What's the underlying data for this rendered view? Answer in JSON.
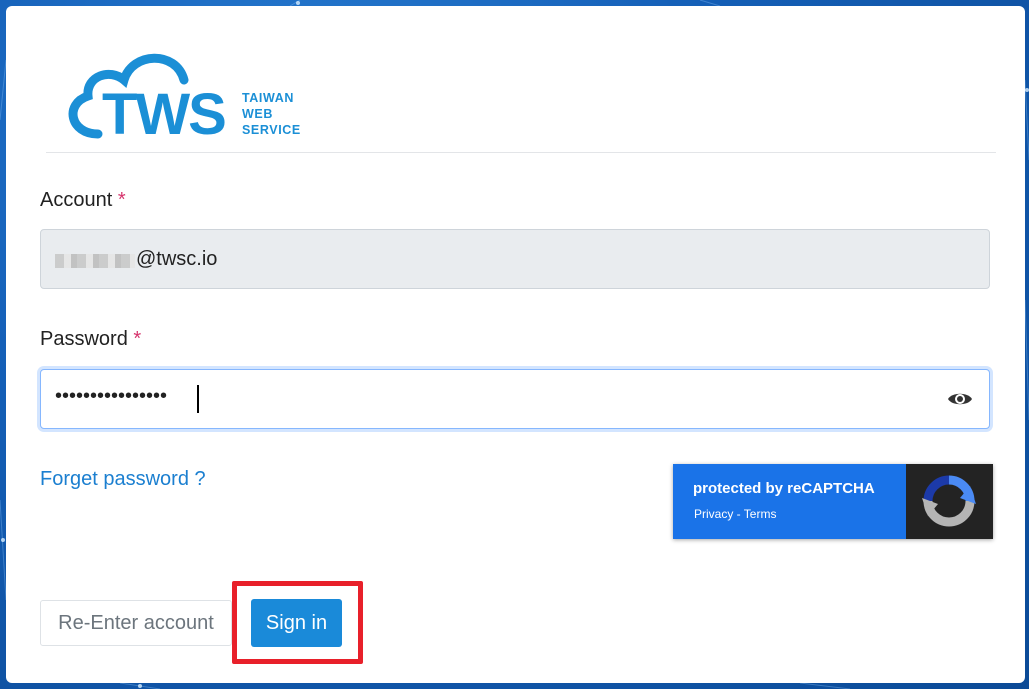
{
  "brand": {
    "logo_text": "TWS",
    "logo_sub_lines": [
      "TAIWAN",
      "WEB",
      "SERVICE"
    ],
    "color": "#1b8fd6"
  },
  "form": {
    "account_label": "Account",
    "password_label": "Password",
    "required_mark": "*",
    "account_value": "@twsc.io",
    "password_value": "••••••••••••••••",
    "show_password_icon": "eye-icon"
  },
  "links": {
    "forget_password": "Forget password ?"
  },
  "recaptcha": {
    "protected_text": "protected by reCAPTCHA",
    "privacy": "Privacy",
    "separator": " - ",
    "terms": "Terms",
    "color": "#1a73e8"
  },
  "buttons": {
    "reenter_label": "Re-Enter account",
    "signin_label": "Sign in",
    "accent": "#1a8ad9"
  }
}
